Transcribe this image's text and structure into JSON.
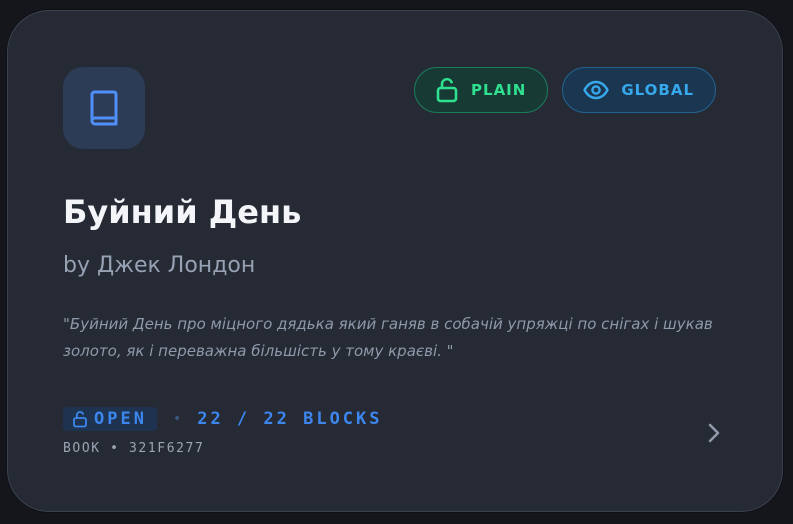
{
  "card": {
    "title": "Буйний День",
    "author": "by Джек Лондон",
    "description": "\"Буйний День про міцного дядька який ганяв в собачій упряжці по снігах і шукав золото, як і переважна більшість у тому краєві. \"",
    "icon": "book-icon"
  },
  "badges": {
    "plain": {
      "label": "PLAIN",
      "icon": "unlock-icon",
      "color": "#2ee08f"
    },
    "global": {
      "label": "GLOBAL",
      "icon": "eye-icon",
      "color": "#38a8ec"
    }
  },
  "status": {
    "state_label": "OPEN",
    "state_icon": "unlock-icon",
    "separator": "•",
    "blocks_label": "22 / 22 BLOCKS",
    "accent": "#3c86ee"
  },
  "meta": {
    "text": "BOOK • 321F6277"
  },
  "navigation": {
    "icon": "chevron-right-icon"
  }
}
